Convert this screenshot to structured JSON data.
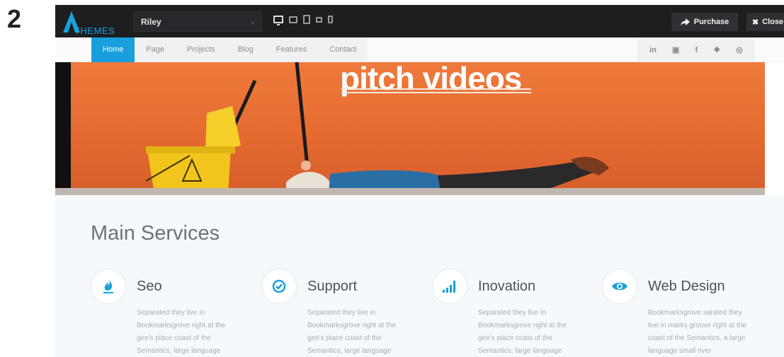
{
  "step_label": "2",
  "colors": {
    "accent": "#1a9fdd",
    "topbar_bg": "#1d1e20",
    "hero_bg": "#e86f34"
  },
  "topbar": {
    "logo_text": "THEMES",
    "theme_select_value": "Riley",
    "device_icons": [
      "desktop-icon",
      "laptop-icon",
      "tablet-icon",
      "phone-landscape-icon",
      "phone-icon"
    ],
    "purchase_label": "Purchase",
    "close_label": "Close"
  },
  "nav": {
    "items": [
      {
        "label": "Home",
        "active": true
      },
      {
        "label": "Page",
        "active": false
      },
      {
        "label": "Projects",
        "active": false
      },
      {
        "label": "Blog",
        "active": false
      },
      {
        "label": "Features",
        "active": false
      },
      {
        "label": "Contact",
        "active": false
      }
    ],
    "social": [
      {
        "icon": "linkedin-icon",
        "glyph": "in"
      },
      {
        "icon": "flickr-icon",
        "glyph": "▣"
      },
      {
        "icon": "facebook-icon",
        "glyph": "f"
      },
      {
        "icon": "dropbox-icon",
        "glyph": "❖"
      },
      {
        "icon": "dribbble-icon",
        "glyph": "◎"
      }
    ]
  },
  "hero": {
    "headline": "pitch videos"
  },
  "services": {
    "title": "Main Services",
    "items": [
      {
        "icon": "flame-icon",
        "title": "Seo",
        "text": "Separated they live in Bookmarksgrove right at the gee's place coast of the Semantics, large language"
      },
      {
        "icon": "check-circle-icon",
        "title": "Support",
        "text": "Separated they live in Bookmarksgrove right at the gee's place coast of the Semantics, large language"
      },
      {
        "icon": "signal-bars-icon",
        "title": "Inovation",
        "text": "Separated they live in Bookmarksgrove right at the gee's place coast of the Semantics, large language"
      },
      {
        "icon": "eye-icon",
        "title": "Web Design",
        "text": "Bookmarksgrove sarated they live in marks groove right at the coast of the Semantics, a large language small river"
      }
    ]
  }
}
